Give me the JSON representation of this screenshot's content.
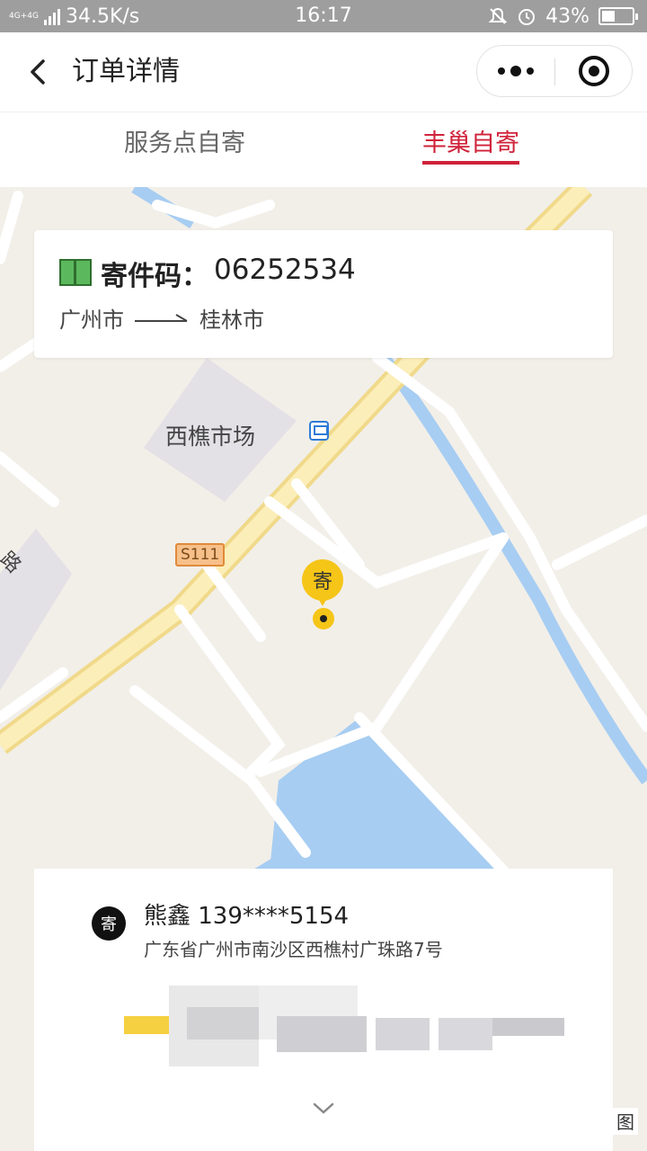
{
  "status_bar": {
    "network": "4G+4G",
    "speed": "34.5K/s",
    "time": "16:17",
    "battery_percent": "43%",
    "battery_level": 0.43
  },
  "header": {
    "title": "订单详情",
    "back_icon": "chevron-left-icon",
    "more_icon": "more-dots-icon",
    "close_icon": "target-icon"
  },
  "tabs": [
    {
      "label": "服务点自寄",
      "active": false
    },
    {
      "label": "丰巢自寄",
      "active": true
    }
  ],
  "accent_color": "#d0223a",
  "order": {
    "code_label": "寄件码：",
    "code_value": "06252534",
    "from": "广州市",
    "to": "桂林市"
  },
  "map": {
    "place_label": "西樵市场",
    "road_badge": "S111",
    "partial_road_label": "路",
    "pin_label": "寄"
  },
  "sender": {
    "badge": "寄",
    "name_phone": "熊鑫 139****5154",
    "address": "广东省广州市南沙区西樵村广珠路7号"
  },
  "corner_mark": "图"
}
